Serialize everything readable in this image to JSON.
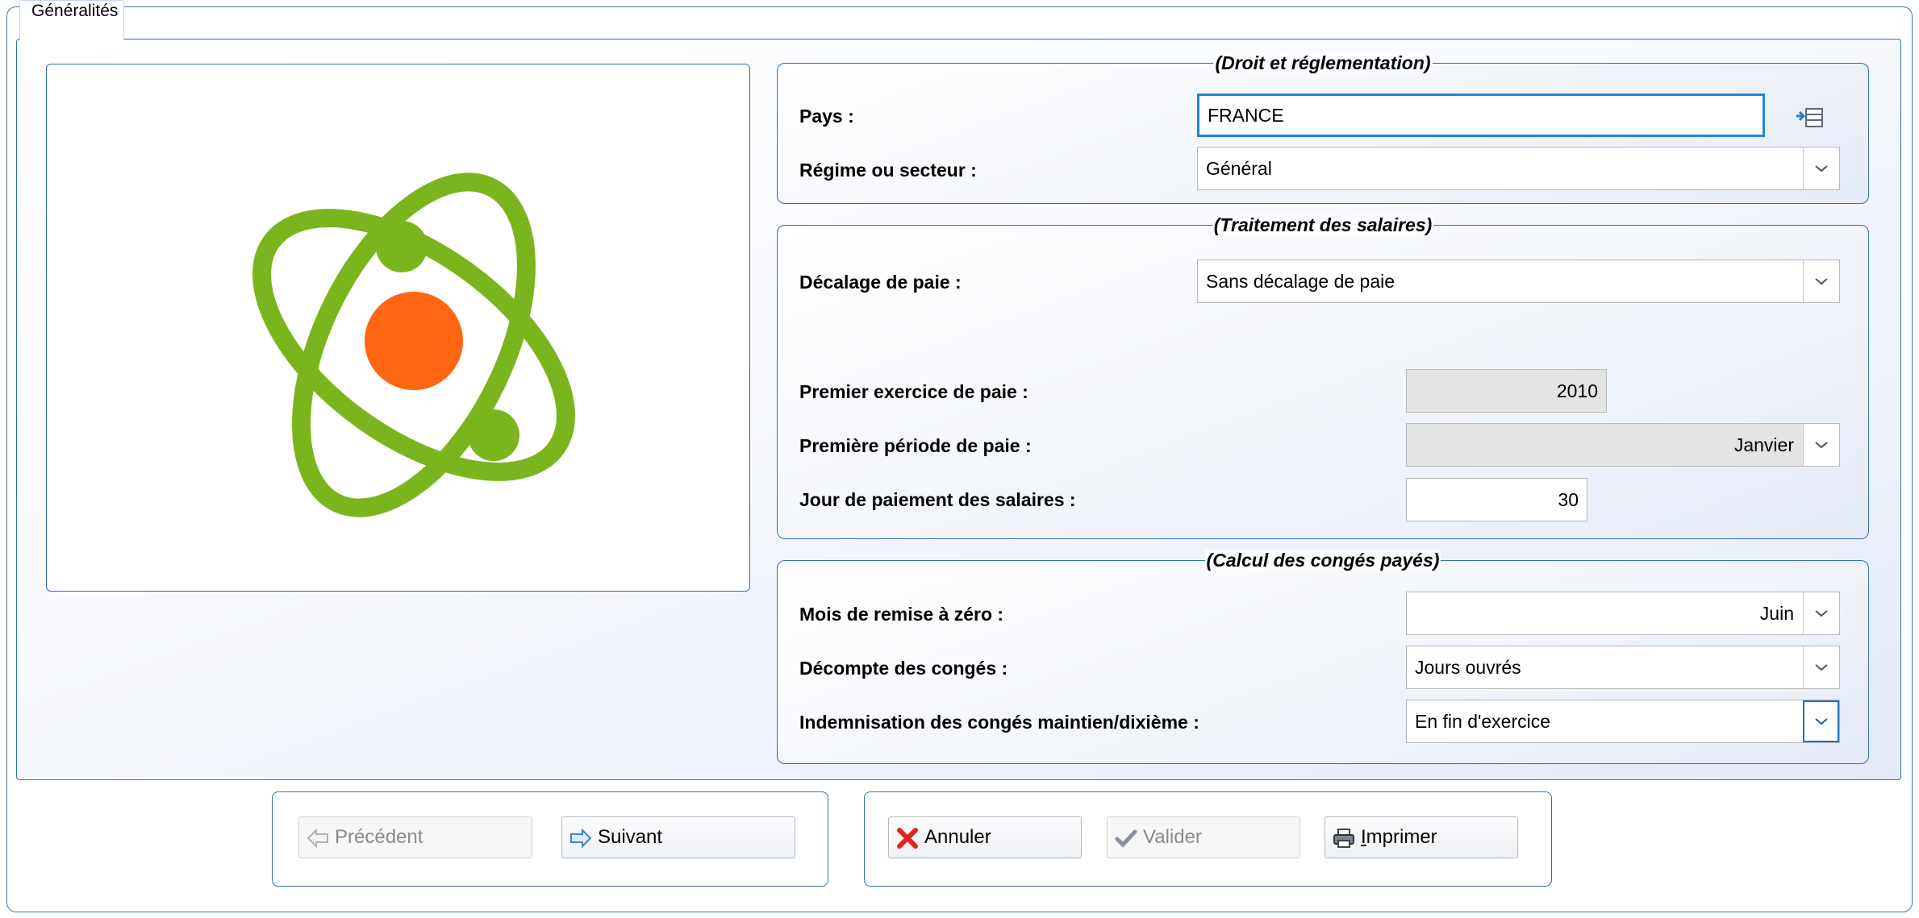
{
  "tab": {
    "label": "Généralités"
  },
  "groups": {
    "droit": {
      "title": "(Droit et réglementation)",
      "pays_label": "Pays :",
      "pays_value": "FRANCE",
      "regime_label": "Régime ou secteur :",
      "regime_value": "Général"
    },
    "traitement": {
      "title": "(Traitement des salaires)",
      "decalage_label": "Décalage de paie :",
      "decalage_value": "Sans décalage de paie",
      "premier_exercice_label": "Premier exercice de paie :",
      "premier_exercice_value": "2010",
      "premiere_periode_label": "Première période de paie :",
      "premiere_periode_value": "Janvier",
      "jour_paiement_label": "Jour de paiement des salaires :",
      "jour_paiement_value": "30"
    },
    "conges": {
      "title": "(Calcul des congés payés)",
      "mois_remise_label": "Mois de remise à zéro :",
      "mois_remise_value": "Juin",
      "decompte_label": "Décompte des congés :",
      "decompte_value": "Jours ouvrés",
      "indemnisation_label": "Indemnisation des congés maintien/dixième :",
      "indemnisation_value": "En fin d'exercice"
    }
  },
  "navigation": {
    "precedent_label": "Précédent",
    "suivant_label": "Suivant"
  },
  "actions": {
    "annuler_label": "Annuler",
    "valider_label": "Valider",
    "imprimer_first": "I",
    "imprimer_rest": "mprimer"
  },
  "colors": {
    "frame_blue": "#2d6fb5",
    "logo_green": "#7ab51d",
    "logo_orange": "#ff6611",
    "focus_blue": "#1f88d6"
  },
  "icons": {
    "pays_action": "select-list-icon",
    "logo": "atom-logo",
    "precedent": "left-arrow-icon",
    "suivant": "right-arrow-icon",
    "annuler": "red-x-icon",
    "valider": "checkmark-icon",
    "imprimer": "printer-icon"
  }
}
